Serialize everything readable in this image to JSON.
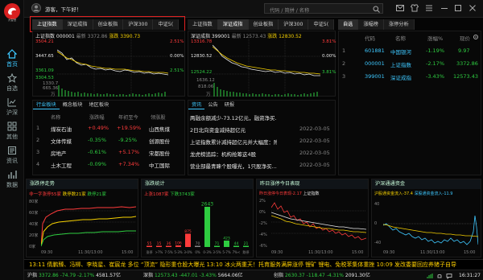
{
  "topbar": {
    "greeting": "游客，下午好！",
    "search_placeholder": "代码 / 简拼 / 名称",
    "logo_text": "大智慧"
  },
  "nav": {
    "items": [
      {
        "label": "首页",
        "icon": "home-icon"
      },
      {
        "label": "自选",
        "icon": "star-icon"
      },
      {
        "label": "沪深",
        "icon": "chart-icon"
      },
      {
        "label": "其他",
        "icon": "grid-icon"
      },
      {
        "label": "资讯",
        "icon": "news-icon"
      },
      {
        "label": "数据",
        "icon": "data-icon"
      }
    ]
  },
  "index_tabs": [
    "上证指数",
    "深证成指",
    "创业板指",
    "沪深300",
    "中证5("
  ],
  "index_tabs2": [
    "上证指数",
    "深证成指",
    "创业板指",
    "沪深300",
    "中证5("
  ],
  "watch_tabs": [
    "自选",
    "涨幅榜",
    "涨停分析"
  ],
  "chart1": {
    "header": {
      "name": "上证指数 000001",
      "price_label": "最新 3372.86",
      "change_label": "涨跌 3390.73"
    },
    "y_labels": [
      "3504.21",
      "3447.65",
      "3361.09",
      "3304.53"
    ],
    "pct_labels": [
      "2.51%",
      "0.00%",
      "2.51%"
    ],
    "vol_labels": [
      "1330.7",
      "665.36",
      "万"
    ],
    "x_labels": [
      "09:30",
      "11:30/13:00",
      "15:00"
    ]
  },
  "chart2": {
    "header": {
      "name": "深证成指 399001",
      "price_label": "最新 12573.43",
      "change_label": "涨跌 12830.52"
    },
    "y_labels": [
      "13316.78",
      "12830.52",
      "12524.22"
    ],
    "pct_labels": [
      "3.81%",
      "0.00%",
      "3.81%"
    ],
    "vol_labels": [
      "1636.12",
      "818.06",
      "万"
    ],
    "x_labels": [
      "09:30",
      "11:30/13:00",
      "15:00"
    ]
  },
  "watchlist": {
    "columns": [
      "代码",
      "名称",
      "涨幅%",
      "现价"
    ],
    "rows": [
      {
        "idx": "1",
        "code": "601881",
        "name": "中国银河",
        "change": "-1.19%",
        "price": "9.97"
      },
      {
        "idx": "2",
        "code": "000001",
        "name": "上证指数",
        "change": "-2.17%",
        "price": "3372.86"
      },
      {
        "idx": "3",
        "code": "399001",
        "name": "深证成指",
        "change": "-3.43%",
        "price": "12573.43"
      }
    ]
  },
  "sector": {
    "tabs": [
      "行业板块",
      "概念板块",
      "地区板块"
    ],
    "columns": [
      "名称",
      "涨跌幅",
      "年初至今",
      "领涨股"
    ],
    "rows": [
      {
        "idx": "1",
        "name": "煤炭石油",
        "change": "+0.49%",
        "ytd": "+19.59%",
        "leader": "山西焦煤"
      },
      {
        "idx": "2",
        "name": "文体传媒",
        "change": "-0.35%",
        "ytd": "-9.25%",
        "leader": "创源股份"
      },
      {
        "idx": "3",
        "name": "房地产",
        "change": "-0.61%",
        "ytd": "+5.17%",
        "leader": "宋都股份"
      },
      {
        "idx": "4",
        "name": "土木工程",
        "change": "-0.09%",
        "ytd": "+7.34%",
        "leader": "中工国际"
      }
    ]
  },
  "news": {
    "tabs": [
      "资讯",
      "公告",
      "研报"
    ],
    "items": [
      {
        "title": "两融余额减少-73.12亿元，融资净买...",
        "date": ""
      },
      {
        "title": "2日北向资金减持超亿元",
        "date": "2022-03-05"
      },
      {
        "title": "上证指数累计减持超亿元并大幅度：附名...",
        "date": "2022-03-05"
      },
      {
        "title": "龙虎榜追踪：机构抢筹这4股",
        "date": "2022-03-05"
      },
      {
        "title": "营业部最青睐个股曝光，1只股净买...",
        "date": "2022-03-05"
      }
    ]
  },
  "limit": {
    "title": "涨跌停走势",
    "legend": [
      "非一字涨停55家",
      "跌停数21家",
      "跌停21家"
    ],
    "y_labels": [
      "80家",
      "60家",
      "40家",
      "20家",
      "0家"
    ],
    "x_labels": [
      "09:30",
      "11:30/13:00",
      "15:00"
    ]
  },
  "dist": {
    "title": "涨跌统计",
    "legend": [
      "上涨1087家",
      "下跌3743家"
    ],
    "bars": [
      {
        "label": "涨停",
        "value": 55
      },
      {
        "label": ">7%",
        "value": 15
      },
      {
        "label": "7-5%",
        "value": 36
      },
      {
        "label": "5-3%",
        "value": 106
      },
      {
        "label": "3-0%",
        "value": 875
      },
      {
        "label": "0%",
        "value": 70
      },
      {
        "label": "0-3%",
        "value": 2643
      },
      {
        "label": "3-5%",
        "value": 71
      },
      {
        "label": "5-7%",
        "value": 423
      },
      {
        "label": "7%<",
        "value": 44
      },
      {
        "label": "跌停",
        "value": 21
      }
    ],
    "bar_value_labels": [
      "2643",
      "71",
      "423"
    ],
    "bar_small_labels": [
      "55",
      "15",
      "36",
      "106",
      "875",
      "70",
      "44",
      "21"
    ]
  },
  "limitup": {
    "title": "昨日涨停今日表现",
    "legend": [
      "昨日涨停今日表现-2.17",
      "上证指数",
      "昨日涨停今日表现-2.1"
    ],
    "y_labels": [
      "2%",
      "0%",
      "-2%",
      "-4%",
      "-6%"
    ],
    "x_labels": [
      "09:30",
      "11:30/13:00",
      "15:00"
    ]
  },
  "hsgt": {
    "title": "沪深通通资金",
    "legend": [
      "沪股通资金流入-37.4",
      "深股通资金流入-11.9",
      "北向资金流入-49.3"
    ],
    "y_labels": [
      "40",
      "0",
      "-40"
    ],
    "x_labels": [
      "09:30",
      "11:30/13:00",
      "15:00"
    ]
  },
  "ticker": {
    "text": "13:11 倩鹏臻、冯柳、李晓星、崔宸龙 多位 “顶流” 隐形重仓股大曝光    13:10 冰火两重天！托育服务满屏涨停 锂矿 锂电、免税苯集体重挫    10:09 发改委要回应养猪子自导"
  },
  "status": {
    "items": [
      {
        "label": "沪指",
        "value": "3372.86",
        "chg": "-74.79",
        "pct": "-2.17%",
        "amt": "4581.57亿"
      },
      {
        "label": "深指",
        "value": "12573.43",
        "chg": "-447.01",
        "pct": "-3.43%",
        "amt": "5664.06亿"
      },
      {
        "label": "创指",
        "value": "2630.37",
        "chg": "-118.47",
        "pct": "-4.31%",
        "amt": "2091.30亿"
      }
    ],
    "time": "16:31:27"
  },
  "colors": {
    "up": "#ff3b3b",
    "down": "#2ecc40",
    "accent": "#f5d000",
    "highlight_box": "#e02020"
  }
}
